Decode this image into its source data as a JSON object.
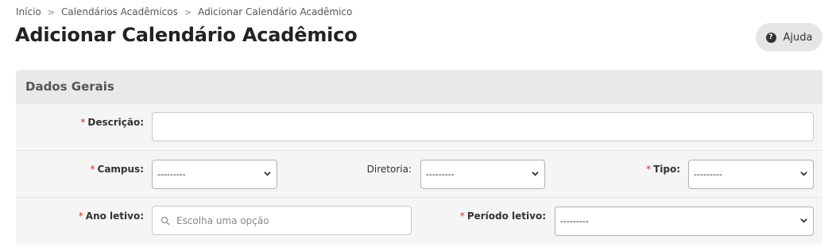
{
  "breadcrumb": {
    "items": [
      "Início",
      "Calendários Acadêmicos",
      "Adicionar Calendário Acadêmico"
    ],
    "separator": ">"
  },
  "page": {
    "title": "Adicionar Calendário Acadêmico"
  },
  "help": {
    "label": "Ajuda",
    "icon": "question-circle-icon"
  },
  "panel": {
    "title": "Dados Gerais",
    "required_marker": "*",
    "fields": {
      "descricao": {
        "label": "Descrição:",
        "value": ""
      },
      "campus": {
        "label": "Campus:",
        "selected": "---------"
      },
      "diretoria": {
        "label": "Diretoria:",
        "selected": "---------"
      },
      "tipo": {
        "label": "Tipo:",
        "selected": "---------"
      },
      "ano_letivo": {
        "label": "Ano letivo:",
        "placeholder": "Escolha uma opção"
      },
      "periodo_letivo": {
        "label": "Período letivo:",
        "selected": "---------"
      }
    }
  },
  "colors": {
    "required": "#c0392b",
    "panel_bg": "#f5f5f5",
    "header_bg": "#e9e9e9"
  }
}
